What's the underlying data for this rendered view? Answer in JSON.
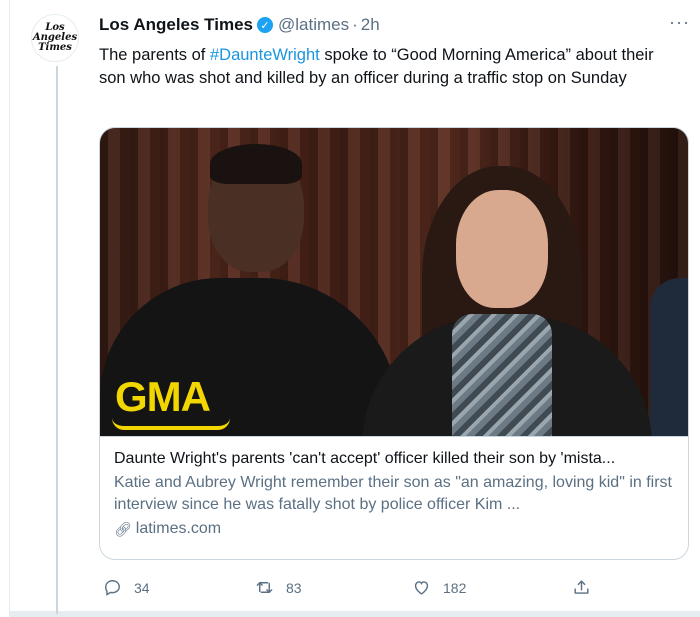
{
  "tweet": {
    "author": {
      "name": "Los Angeles Times",
      "handle": "@latimes",
      "separator": "·",
      "time": "2h",
      "avatar_lines": [
        "Los",
        "Angeles",
        "Times"
      ],
      "verified": true
    },
    "text": {
      "prefix": "The parents of ",
      "hashtag": "#DaunteWright",
      "suffix": " spoke to “Good Morning America” about their son who was shot and killed by an officer during a traffic stop on Sunday"
    },
    "card": {
      "image_logo": "GMA",
      "title": "Daunte Wright's parents 'can't accept' officer killed their son by 'mista...",
      "description": "Katie and Aubrey Wright remember their son as \"an amazing, loving kid\" in first interview since he was fatally shot by police officer Kim ...",
      "domain": "latimes.com"
    },
    "actions": {
      "replies": "34",
      "retweets": "83",
      "likes": "182"
    },
    "icons": {
      "more": "more-options-icon",
      "verified": "verified-badge-icon",
      "reply": "reply-icon",
      "retweet": "retweet-icon",
      "like": "heart-icon",
      "share": "share-icon",
      "link": "link-icon"
    },
    "colors": {
      "link": "#1b95e0",
      "verified": "#1da1f2",
      "muted": "#5b7083",
      "gma_yellow": "#f2d600"
    }
  }
}
